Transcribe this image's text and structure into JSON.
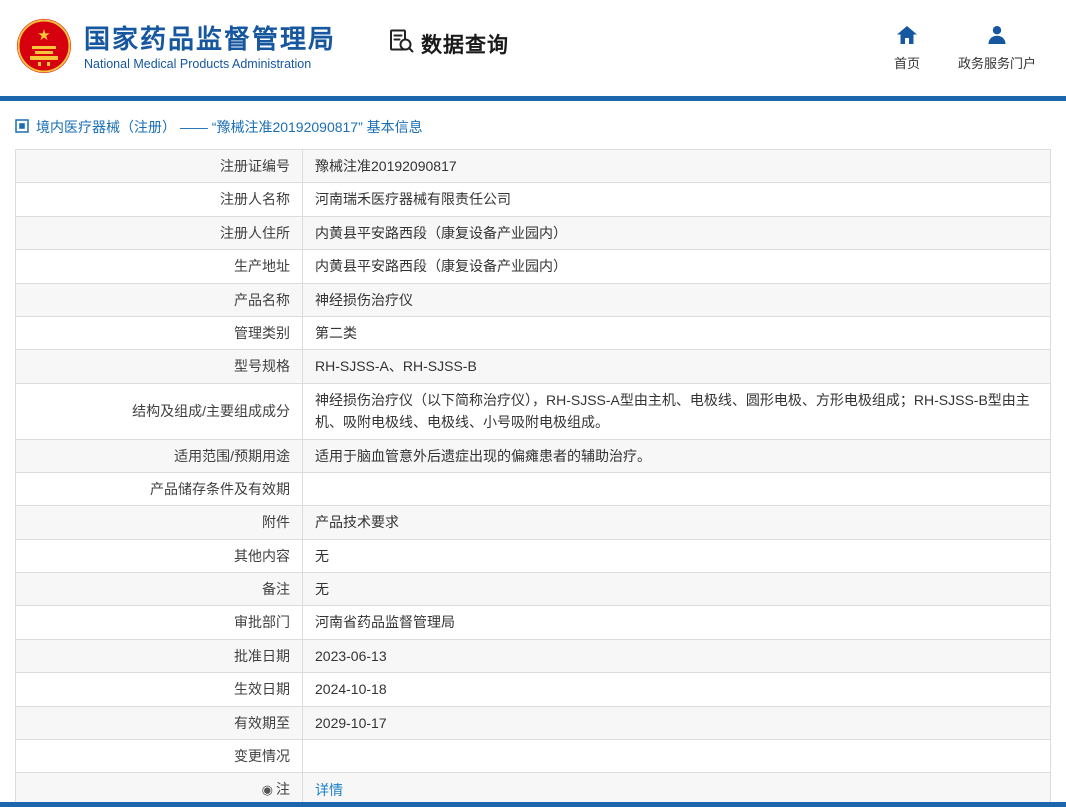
{
  "header": {
    "org_name_cn": "国家药品监督管理局",
    "org_name_en": "National Medical Products Administration",
    "section_title": "数据查询",
    "nav": [
      {
        "label": "首页",
        "icon": "home-icon"
      },
      {
        "label": "政务服务门户",
        "icon": "user-icon"
      }
    ]
  },
  "breadcrumb": {
    "icon": "category-icon",
    "text": "境内医疗器械（注册） —— “豫械注准20192090817” 基本信息"
  },
  "table": {
    "rows": [
      {
        "label": "注册证编号",
        "value": "豫械注准20192090817"
      },
      {
        "label": "注册人名称",
        "value": "河南瑞禾医疗器械有限责任公司"
      },
      {
        "label": "注册人住所",
        "value": "内黄县平安路西段（康复设备产业园内）"
      },
      {
        "label": "生产地址",
        "value": "内黄县平安路西段（康复设备产业园内）"
      },
      {
        "label": "产品名称",
        "value": "神经损伤治疗仪"
      },
      {
        "label": "管理类别",
        "value": "第二类"
      },
      {
        "label": "型号规格",
        "value": "RH-SJSS-A、RH-SJSS-B"
      },
      {
        "label": "结构及组成/主要组成成分",
        "value": "神经损伤治疗仪（以下简称治疗仪），RH-SJSS-A型由主机、电极线、圆形电极、方形电极组成；RH-SJSS-B型由主机、吸附电极线、电极线、小号吸附电极组成。"
      },
      {
        "label": "适用范围/预期用途",
        "value": "适用于脑血管意外后遗症出现的偏瘫患者的辅助治疗。"
      },
      {
        "label": "产品储存条件及有效期",
        "value": ""
      },
      {
        "label": "附件",
        "value": "产品技术要求"
      },
      {
        "label": "其他内容",
        "value": "无"
      },
      {
        "label": "备注",
        "value": "无"
      },
      {
        "label": "审批部门",
        "value": "河南省药品监督管理局"
      },
      {
        "label": "批准日期",
        "value": "2023-06-13"
      },
      {
        "label": "生效日期",
        "value": "2024-10-18"
      },
      {
        "label": "有效期至",
        "value": "2029-10-17"
      },
      {
        "label": "变更情况",
        "value": ""
      },
      {
        "label": "注",
        "label_icon": "note-icon",
        "value": "详情",
        "link": true
      }
    ]
  },
  "colors": {
    "brand_blue": "#1657a0",
    "divider_blue": "#1b66ad",
    "link_blue": "#1b7fc4",
    "stripe_gray": "#f7f7f7",
    "border_gray": "#dcdcdc"
  }
}
